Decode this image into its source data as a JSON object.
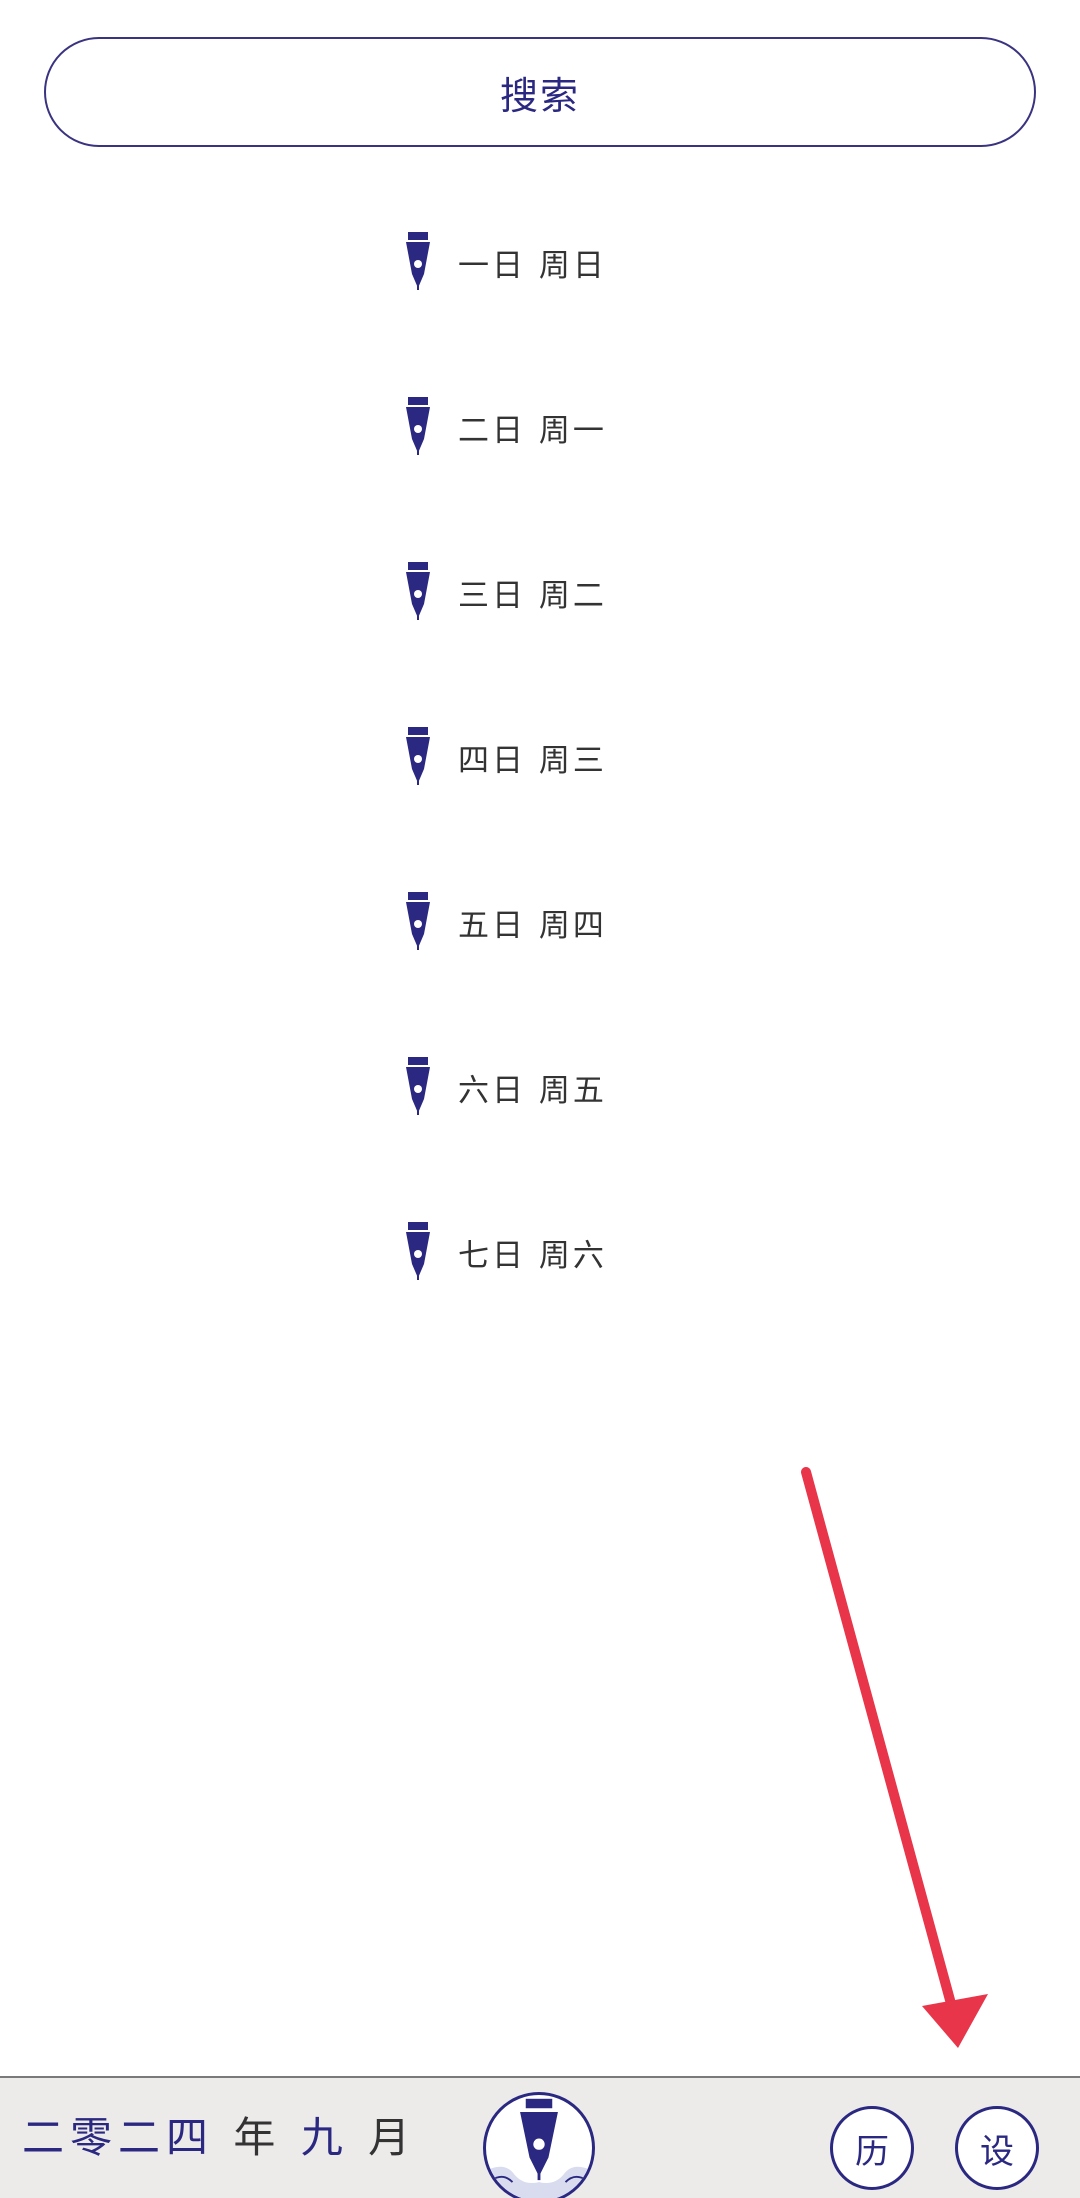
{
  "search": {
    "label": "搜索"
  },
  "days": [
    {
      "label": "一日 周日"
    },
    {
      "label": "二日 周一"
    },
    {
      "label": "三日 周二"
    },
    {
      "label": "四日 周三"
    },
    {
      "label": "五日 周四"
    },
    {
      "label": "六日 周五"
    },
    {
      "label": "七日 周六"
    }
  ],
  "bottom_bar": {
    "year": "二零二四",
    "year_word": "年",
    "month": "九",
    "month_word": "月",
    "history_label": "历",
    "settings_label": "设"
  },
  "colors": {
    "accent": "#2a2880",
    "arrow": "#e8354a",
    "bar_bg": "#edeaea"
  },
  "icons": {
    "day_item": "fountain-pen-icon",
    "center": "fountain-pen-logo-icon"
  }
}
